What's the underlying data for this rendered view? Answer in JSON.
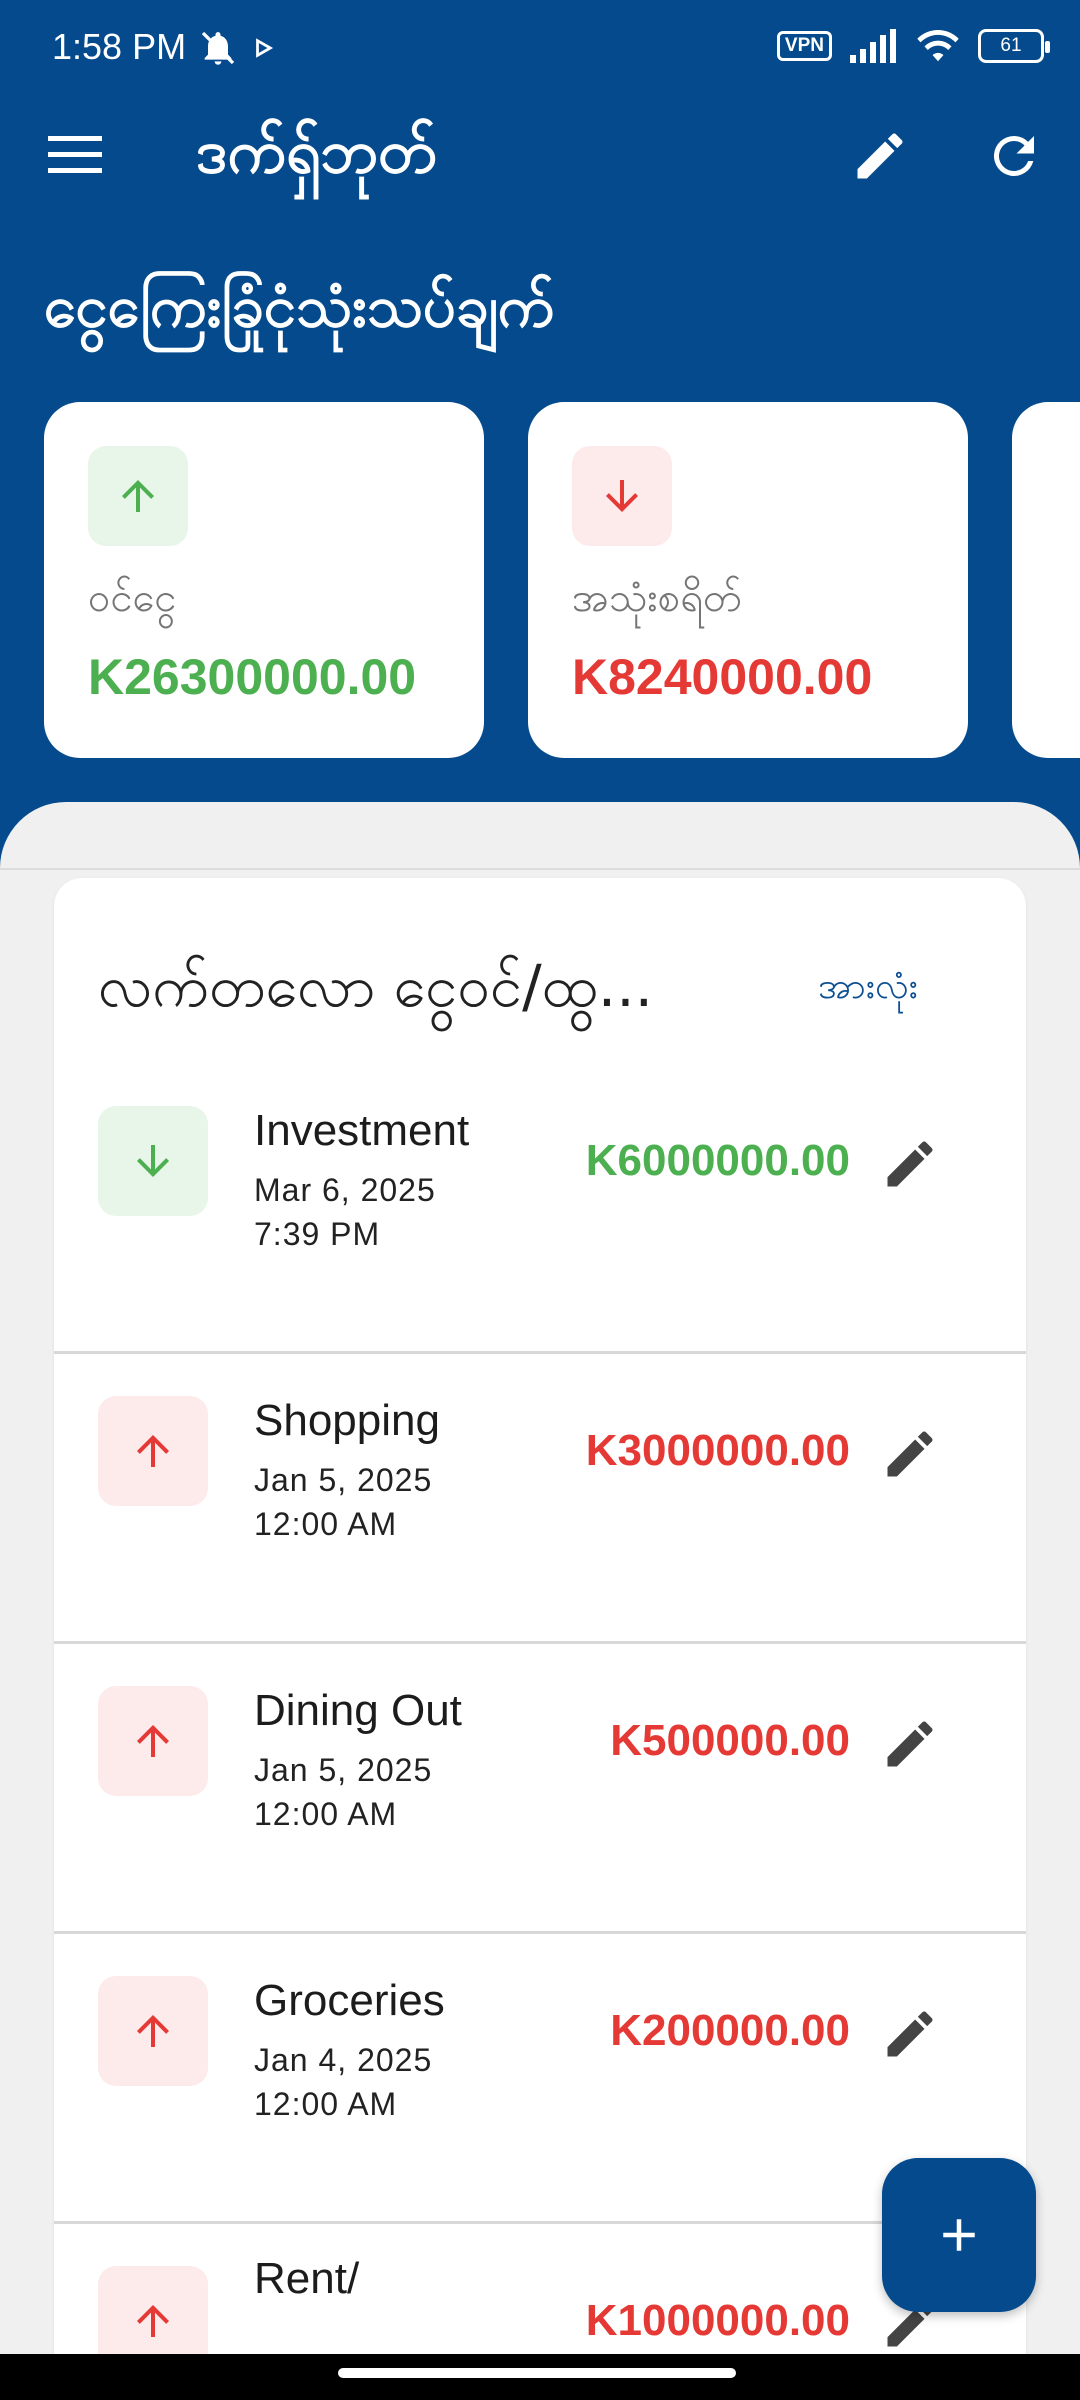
{
  "status_bar": {
    "time": "1:58 PM",
    "vpn": "VPN",
    "battery": "61"
  },
  "app_bar": {
    "title": "ဒက်ရှ်ဘုတ်"
  },
  "summary": {
    "title": "ငွေကြေးခြုံငုံသုံးသပ်ချက်",
    "cards": [
      {
        "label": "ဝင်ငွေ",
        "value": "K26300000.00",
        "direction": "up",
        "color": "#4caf50",
        "bg": "#e8f5e9"
      },
      {
        "label": "အသုံးစရိတ်",
        "value": "K8240000.00",
        "direction": "down",
        "color": "#e53935",
        "bg": "#fdeaea"
      }
    ]
  },
  "recent": {
    "title": "လက်တလော ငွေဝင်/ထွ...",
    "see_all": "အားလုံး",
    "items": [
      {
        "title": "Investment",
        "date": "Mar 6, 2025",
        "time": "7:39 PM",
        "amount": "K6000000.00",
        "type": "income"
      },
      {
        "title": "Shopping",
        "date": "Jan 5, 2025",
        "time": "12:00 AM",
        "amount": "K3000000.00",
        "type": "expense"
      },
      {
        "title": "Dining Out",
        "date": "Jan 5, 2025",
        "time": "12:00 AM",
        "amount": "K500000.00",
        "type": "expense"
      },
      {
        "title": "Groceries",
        "date": "Jan 4, 2025",
        "time": "12:00 AM",
        "amount": "K200000.00",
        "type": "expense"
      },
      {
        "title": "Rent/",
        "date": "",
        "time": "",
        "amount": "K1000000.00",
        "type": "expense"
      }
    ]
  },
  "colors": {
    "primary": "#044a8c",
    "income": "#4caf50",
    "income_bg": "#e8f5e9",
    "expense": "#e53935",
    "expense_bg": "#fdeaea"
  },
  "icons": {
    "menu": "menu-icon",
    "edit": "pencil-icon",
    "refresh": "refresh-icon",
    "add": "plus-icon"
  }
}
